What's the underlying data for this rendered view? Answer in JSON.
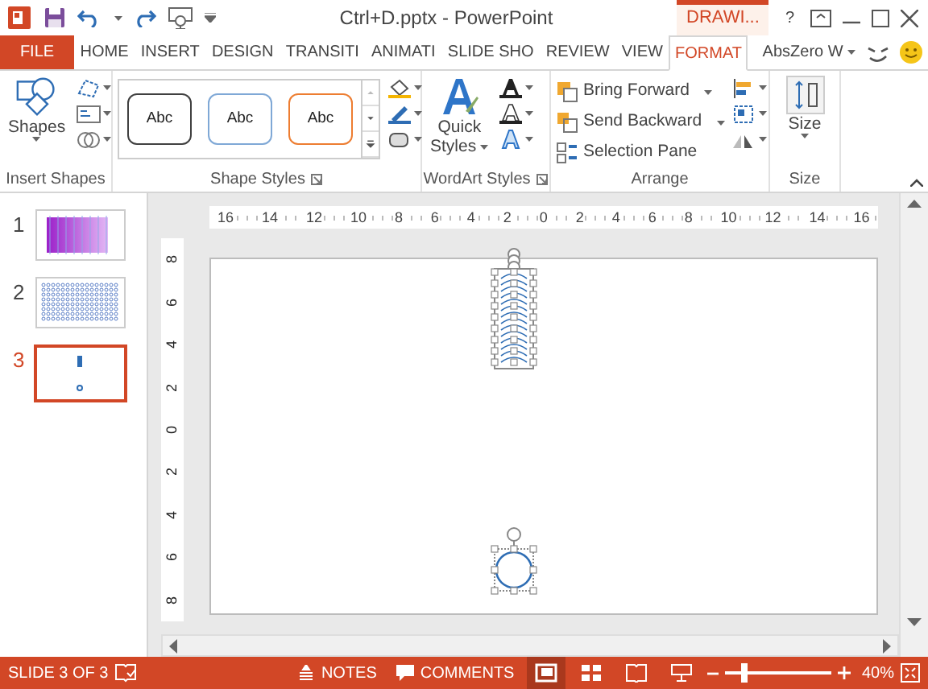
{
  "window": {
    "title": "Ctrl+D.pptx - PowerPoint",
    "context_tab": "DRAWI...",
    "help": "?"
  },
  "tabs": [
    {
      "label": "FILE",
      "kind": "file",
      "selected": false
    },
    {
      "label": "HOME",
      "kind": "tab",
      "selected": false
    },
    {
      "label": "INSERT",
      "kind": "tab",
      "selected": false
    },
    {
      "label": "DESIGN",
      "kind": "tab",
      "selected": false
    },
    {
      "label": "TRANSITI",
      "kind": "tab",
      "selected": false
    },
    {
      "label": "ANIMATI",
      "kind": "tab",
      "selected": false
    },
    {
      "label": "SLIDE SHO",
      "kind": "tab",
      "selected": false
    },
    {
      "label": "REVIEW",
      "kind": "tab",
      "selected": false
    },
    {
      "label": "VIEW",
      "kind": "tab",
      "selected": false
    },
    {
      "label": "FORMAT",
      "kind": "tab",
      "selected": true
    }
  ],
  "account": {
    "name": "AbsZero W"
  },
  "ribbon": {
    "groups": [
      {
        "kind": "insert_shapes",
        "label": "Insert Shapes",
        "button": "Shapes"
      },
      {
        "kind": "shape_styles",
        "label": "Shape Styles",
        "styles": [
          {
            "text": "Abc",
            "color": "#404040"
          },
          {
            "text": "Abc",
            "color": "#7fa8d6"
          },
          {
            "text": "Abc",
            "color": "#ed7d31"
          }
        ]
      },
      {
        "kind": "wordart",
        "label": "WordArt Styles",
        "button_lines": [
          "Quick",
          "Styles"
        ]
      },
      {
        "kind": "arrange",
        "label": "Arrange",
        "commands": [
          {
            "label": "Bring Forward",
            "dropdown": true
          },
          {
            "label": "Send Backward",
            "dropdown": true
          },
          {
            "label": "Selection Pane",
            "dropdown": false
          }
        ]
      },
      {
        "kind": "size",
        "label": "Size",
        "button": "Size"
      }
    ]
  },
  "slides": [
    {
      "number": "1",
      "kind": "gradient",
      "selected": false
    },
    {
      "number": "2",
      "kind": "dots",
      "selected": false
    },
    {
      "number": "3",
      "kind": "shapes",
      "selected": true
    }
  ],
  "rulers": {
    "horizontal": [
      "16",
      "14",
      "12",
      "10",
      "8",
      "6",
      "4",
      "2",
      "0",
      "2",
      "4",
      "6",
      "8",
      "10",
      "12",
      "14",
      "16"
    ],
    "vertical": [
      "8",
      "6",
      "4",
      "2",
      "0",
      "2",
      "4",
      "6",
      "8"
    ]
  },
  "status_bar": {
    "slide_info": "SLIDE 3 OF 3",
    "notes": "NOTES",
    "comments": "COMMENTS",
    "views": [
      {
        "kind": "normal",
        "selected": true
      },
      {
        "kind": "sorter",
        "selected": false
      },
      {
        "kind": "reading",
        "selected": false
      },
      {
        "kind": "slideshow",
        "selected": false
      }
    ],
    "zoom": {
      "level": 0.15,
      "reading": "40%"
    }
  }
}
